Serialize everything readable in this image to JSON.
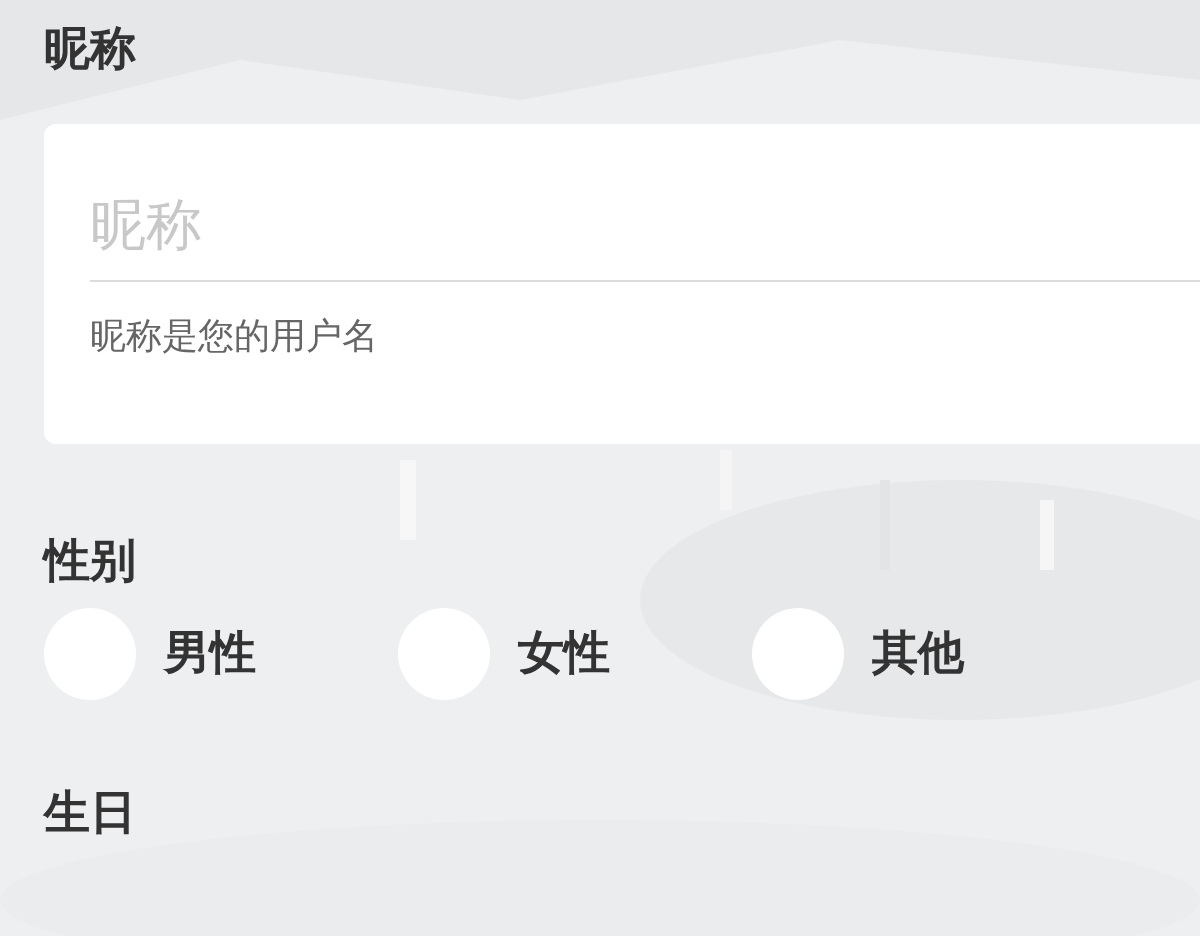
{
  "nickname": {
    "label": "昵称",
    "placeholder": "昵称",
    "helper": "昵称是您的用户名"
  },
  "gender": {
    "label": "性别",
    "options": [
      {
        "label": "男性",
        "selected": false
      },
      {
        "label": "女性",
        "selected": false
      },
      {
        "label": "其他",
        "selected": false
      }
    ]
  },
  "birthday": {
    "label": "生日"
  }
}
